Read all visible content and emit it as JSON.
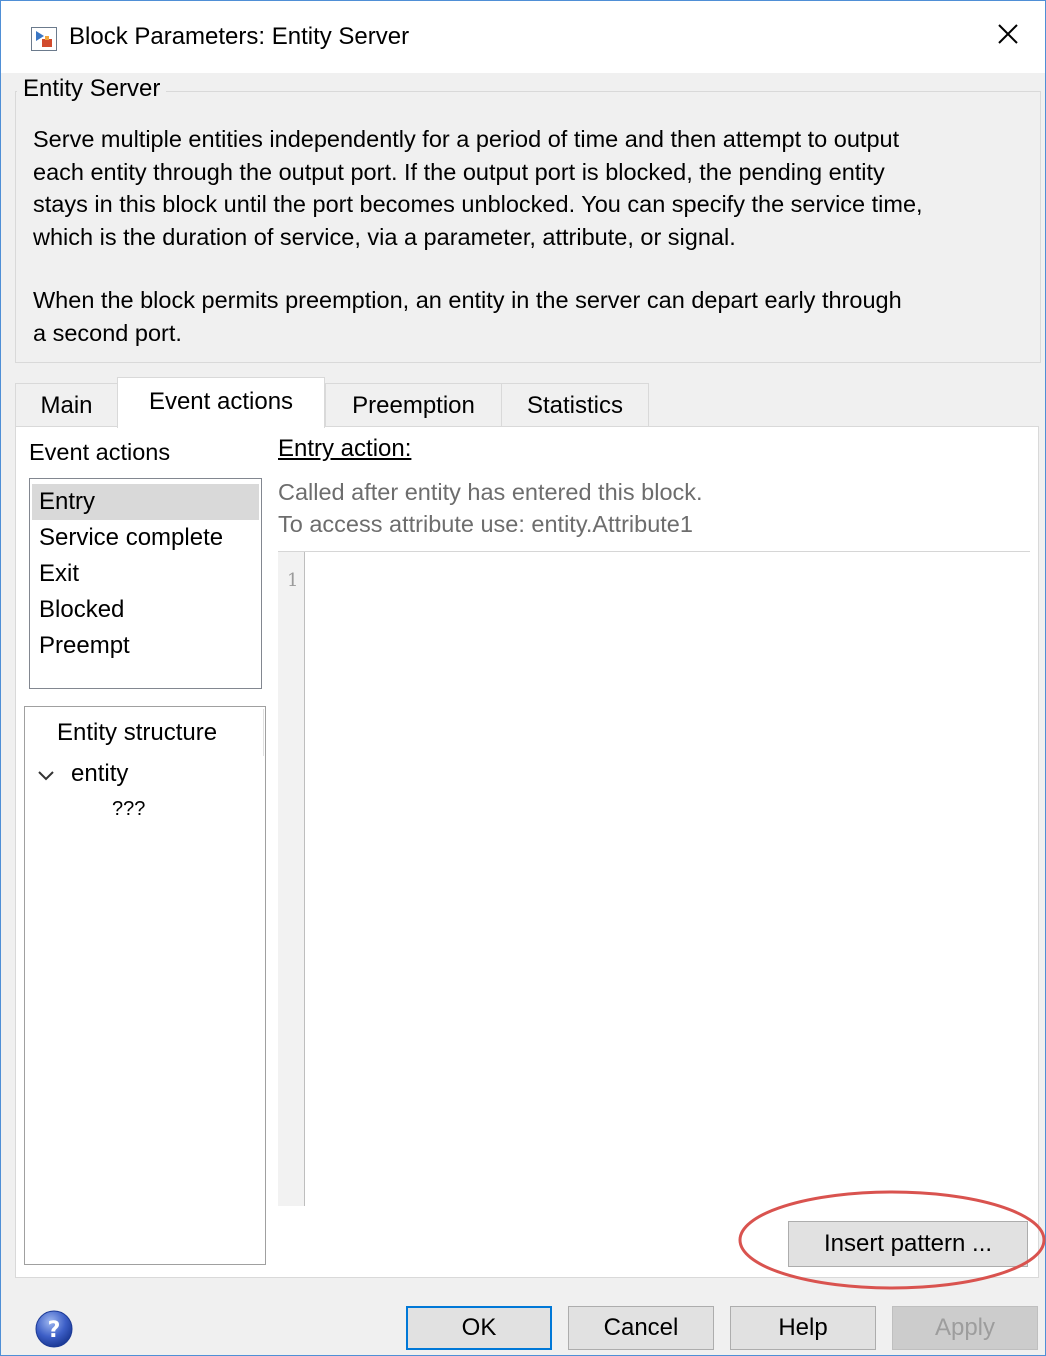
{
  "window": {
    "title": "Block Parameters: Entity Server",
    "icon": "simulink-block-icon",
    "close_icon": "close-icon"
  },
  "description": {
    "heading": "Entity Server",
    "para1_lines": [
      "Serve multiple entities independently for a period of time and then attempt to output",
      "each entity through the output port. If the output port is blocked, the pending entity",
      "stays in this block until the port becomes unblocked. You can specify the service time,",
      "which is the duration of service, via a parameter, attribute, or signal."
    ],
    "para2_lines": [
      "When the block permits preemption, an entity in the server can depart early through",
      "a second port."
    ]
  },
  "tabs": [
    {
      "label": "Main",
      "active": false
    },
    {
      "label": "Event actions",
      "active": true
    },
    {
      "label": "Preemption",
      "active": false
    },
    {
      "label": "Statistics",
      "active": false
    }
  ],
  "event_actions": {
    "label": "Event actions",
    "items": [
      "Entry",
      "Service complete",
      "Exit",
      "Blocked",
      "Preempt"
    ],
    "selected": "Entry"
  },
  "entity_structure": {
    "title": "Entity structure",
    "root": "entity",
    "child": "???"
  },
  "entry_action": {
    "title": "Entry action:",
    "hint1": "Called after entity has entered this block.",
    "hint2": "To access attribute use: entity.Attribute1",
    "line_number": "1",
    "code": ""
  },
  "insert_pattern_label": "Insert pattern ...",
  "footer": {
    "help_icon": "question-mark-icon",
    "ok_label": "OK",
    "cancel_label": "Cancel",
    "help_label": "Help",
    "apply_label": "Apply"
  },
  "colors": {
    "accent": "#0078d7",
    "highlight_ring": "#d9534f",
    "selected_item_bg": "#d9d9d9"
  }
}
